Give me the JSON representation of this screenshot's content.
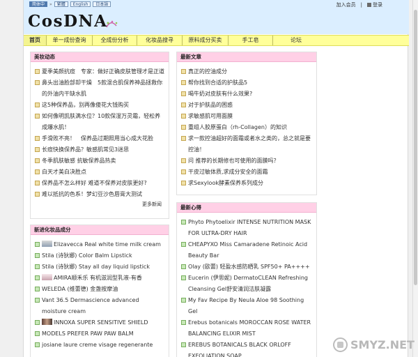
{
  "header": {
    "lang_simplified": "简体中",
    "lang_sep": "»",
    "lang_items": [
      "繁體",
      "English",
      "日本語"
    ],
    "account_join": "加入会员",
    "account_sep": "|",
    "account_login": "登录",
    "logo_text": "CosDNA"
  },
  "nav": {
    "items": [
      "首页",
      "单一成份查询",
      "全成份分析",
      "化妆品搜寻",
      "原料成分买卖",
      "手工皂",
      "论坛"
    ]
  },
  "beauty_news": {
    "title": "美妆动态",
    "items": [
      "夏季美颜抗痘　专家：做好正确皮肤管理才是正道",
      "鼻头出油脸部却干燥　5款混合肌保养神品拯救你的外油内干缺水肌",
      "这5种保养品，别再像傻花大钱购买",
      "如何像明凯肤满水位？10款保湿万灵霜，轻松养成爆水肌！",
      "手滑败不亮！　保养品过期照用当心成大花脸",
      "长痘快换保养品？敏感肌常见3迷思",
      "冬季肌肤敏感 抗敏保养品热卖",
      "白天才美白决胜点",
      "保养品不怎么样好 难道不保养对皮肤更好?",
      "难以抵抗的色系！梦幻豆沙色唇膏大测试"
    ],
    "more": "更多新闻"
  },
  "latest_articles": {
    "title": "最新文章",
    "items": [
      "真正的控油成分",
      "帮你找到合适的护肤品5",
      "喝牛奶对皮肤有什么效果?",
      "对于护肤品的困惑",
      "求敏感肌可用面膜",
      "重组人胶原蛋白（rh-Collagen）的知识",
      "求一款控油超好的面霜或者水之类的，总之就是要控油！",
      "问 推荐的长期修也可使用的面膜吗？",
      "干皮过敏体质,求成分安全的面霜",
      "求Sexylook酵素保养系列成分"
    ]
  },
  "new_products": {
    "title": "新进化妆品成分",
    "items": [
      {
        "text": "Elizavecca Real white time milk cream",
        "thumb": "a"
      },
      {
        "text": "Stila (诗狄娜) Color Balm Lipstick",
        "thumb": ""
      },
      {
        "text": "Stila (诗狄娜) Stay all day liquid lipstick",
        "thumb": ""
      },
      {
        "text": "AMIRA顺禾乐 有机滋润型乳液-有香",
        "thumb": "a"
      },
      {
        "text": "WELEDA (维蕾德) 金盏按摩油",
        "thumb": ""
      },
      {
        "text": "Vant 36.5 Dermascience advanced moisture cream",
        "thumb": ""
      },
      {
        "text": "INNOXA SUPER SENSITIVE SHIELD",
        "thumb": "b"
      },
      {
        "text": "MODELS PREFER PAW PAW BALM",
        "thumb": ""
      },
      {
        "text": "josiane laure creme visage regenerante",
        "thumb": ""
      }
    ]
  },
  "reviews": {
    "title": "最新心得",
    "items": [
      "Phyto Phytoelixir INTENSE NUTRITION MASK FOR ULTRA-DRY HAIR",
      "CHEAPYXO Miss Camaradene Retinoic Acid Beauty Bar",
      "Olay (歐蕾) 轻盈水感防晒乳 SPF50+ PA++++",
      "Eucerin (伊思妮) DermatoCLEAN Refreshing Cleansing Gel舒安清润洁肤凝露",
      "My Fav Recipe By Neula Aloe 98 Soothing Gel",
      "Erebus botanicals MOROCCAN ROSE WATER BALANCING ELIXIR MIST",
      "EREBUS BOTANICALS BLACK ORLOFF EXFOLIATION SOAP"
    ]
  },
  "watermark": {
    "text": "SMYZ.NET"
  }
}
